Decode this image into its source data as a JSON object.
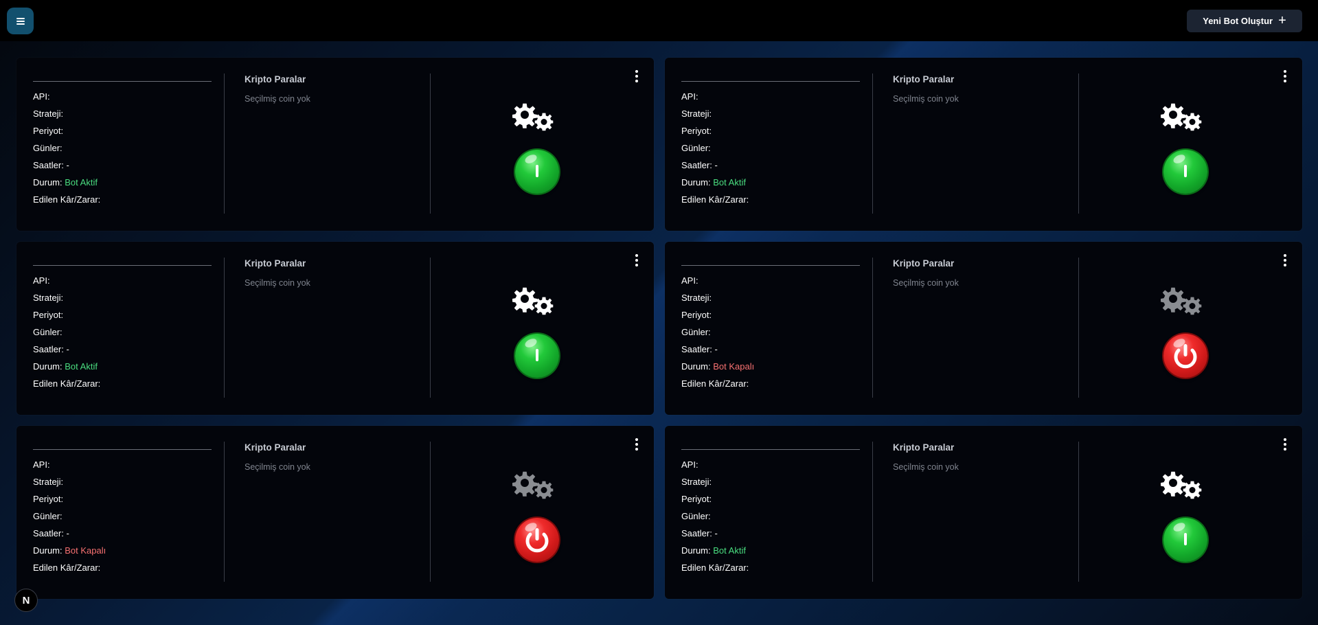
{
  "header": {
    "new_bot_label": "Yeni Bot Oluştur"
  },
  "labels": {
    "api": "API:",
    "strategy": "Strateji:",
    "period": "Periyot:",
    "days": "Günler:",
    "hours": "Saatler:",
    "status": "Durum:",
    "pnl": "Edilen Kâr/Zarar:",
    "coins_title": "Kripto Paralar",
    "coins_empty": "Seçilmiş coin yok"
  },
  "colors": {
    "active": "#4ade80",
    "inactive": "#f87171",
    "menu_button": "#12506e"
  },
  "icons": {
    "menu": "hamburger-icon",
    "settings": "gears-icon",
    "power": "power-icon",
    "more": "kebab-icon",
    "add": "plus-icon"
  },
  "bots": [
    {
      "api": "",
      "strategy": "",
      "period": "",
      "days": "",
      "hours": "-",
      "status": "Bot Aktif",
      "active": true,
      "pnl": ""
    },
    {
      "api": "",
      "strategy": "",
      "period": "",
      "days": "",
      "hours": "-",
      "status": "Bot Aktif",
      "active": true,
      "pnl": ""
    },
    {
      "api": "",
      "strategy": "",
      "period": "",
      "days": "",
      "hours": "-",
      "status": "Bot Aktif",
      "active": true,
      "pnl": ""
    },
    {
      "api": "",
      "strategy": "",
      "period": "",
      "days": "",
      "hours": "-",
      "status": "Bot Kapalı",
      "active": false,
      "pnl": ""
    },
    {
      "api": "",
      "strategy": "",
      "period": "",
      "days": "",
      "hours": "-",
      "status": "Bot Kapalı",
      "active": false,
      "pnl": ""
    },
    {
      "api": "",
      "strategy": "",
      "period": "",
      "days": "",
      "hours": "-",
      "status": "Bot Aktif",
      "active": true,
      "pnl": ""
    }
  ],
  "badge": {
    "letter": "N"
  }
}
